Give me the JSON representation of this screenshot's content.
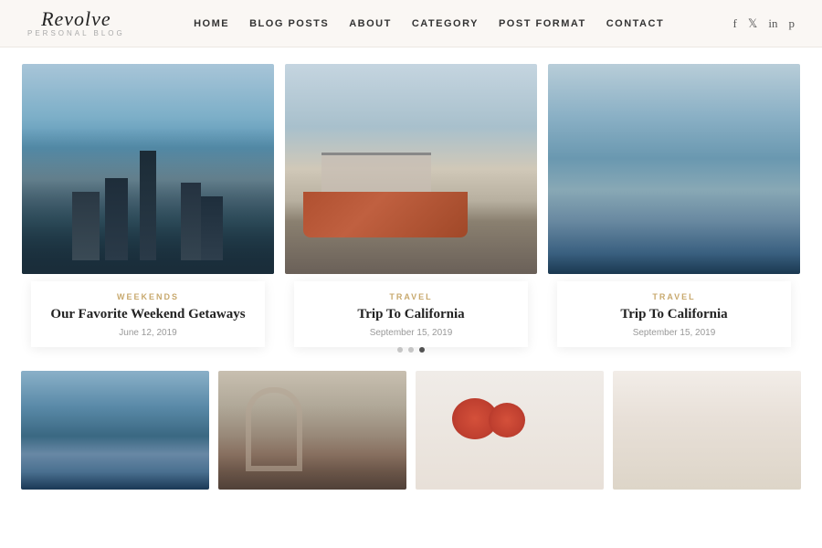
{
  "header": {
    "logo": "Revolve",
    "logo_sub": "PERSONAL BLOG",
    "nav": {
      "home": "HOME",
      "blog_posts": "BLOG POSTS",
      "about": "ABOUT",
      "category": "CATEGORY",
      "post_format": "POST FORMAT",
      "contact": "CONTACT"
    }
  },
  "featured": {
    "cards": [
      {
        "category": "WEEKENDS",
        "title": "Our Favorite Weekend Getaways",
        "date": "June 12, 2019"
      },
      {
        "category": "TRAVEL",
        "title": "Trip To California",
        "date": "September 15, 2019"
      },
      {
        "category": "TRAVEL",
        "title": "Trip To California",
        "date": "September 15, 2019"
      }
    ],
    "dots": [
      {
        "active": false
      },
      {
        "active": false
      },
      {
        "active": true
      }
    ]
  },
  "social": {
    "facebook": "f",
    "twitter": "t",
    "linkedin": "in",
    "pinterest": "p"
  }
}
